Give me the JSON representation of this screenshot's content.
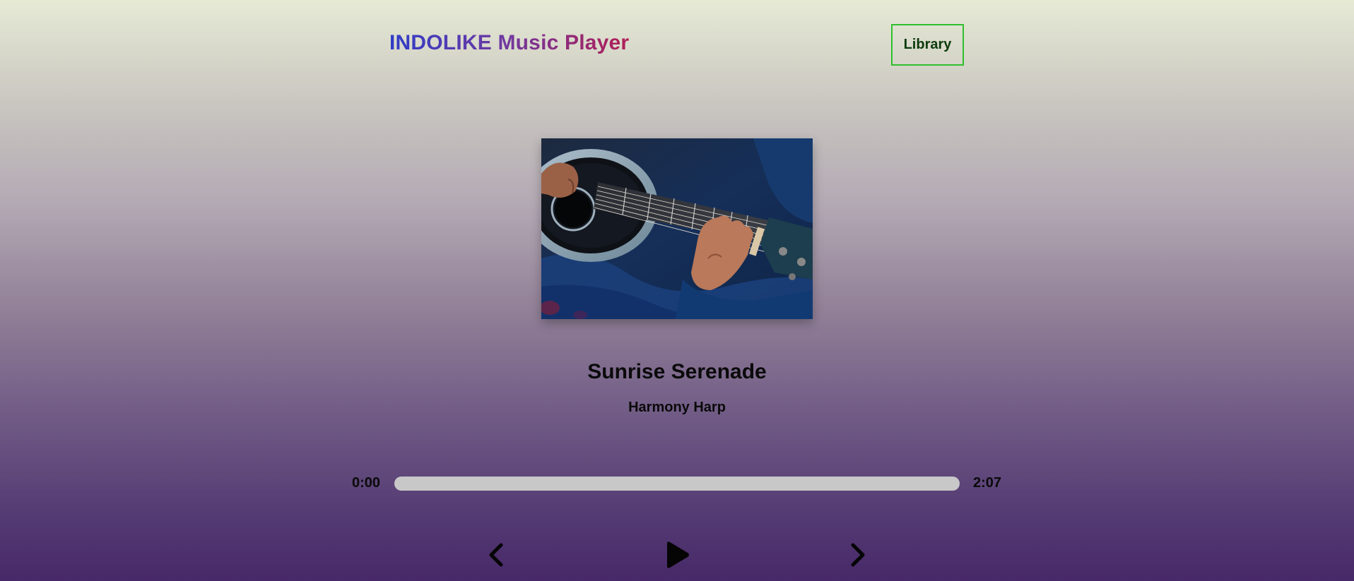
{
  "header": {
    "title": "INDOLIKE Music Player",
    "library_label": "Library"
  },
  "track": {
    "title": "Sunrise Serenade",
    "artist": "Harmony Harp",
    "cover_alt": "album-cover-guitar-player"
  },
  "player": {
    "current_time": "0:00",
    "total_time": "2:07",
    "progress": 0,
    "controls": {
      "prev_icon": "chevron-left-icon",
      "play_icon": "play-icon",
      "next_icon": "chevron-right-icon"
    }
  },
  "colors": {
    "title_gradient_start": "#2f3dc7",
    "title_gradient_end": "#b01e55",
    "library_border": "#2fbf2f",
    "progress_track": "#c8c8c8",
    "background_top": "#e6ead5",
    "background_bottom": "#472868"
  }
}
